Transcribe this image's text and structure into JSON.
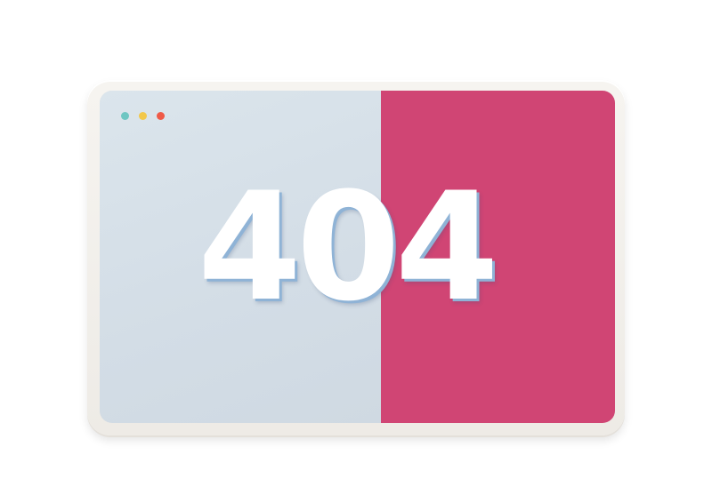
{
  "window": {
    "controls": [
      {
        "name": "minimize",
        "color": "#6ec6c2"
      },
      {
        "name": "maximize",
        "color": "#f2c84b"
      },
      {
        "name": "close",
        "color": "#ef5a47"
      }
    ]
  },
  "panels": {
    "left_color": "#d7e1e9",
    "right_color": "#d04574"
  },
  "error": {
    "code": "404"
  }
}
